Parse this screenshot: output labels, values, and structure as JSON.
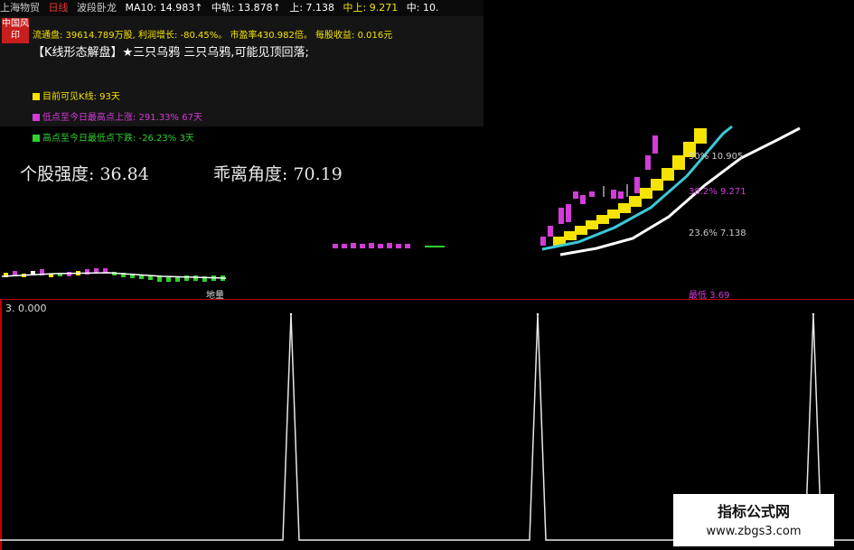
{
  "header": {
    "stock_name": "上海物贸",
    "period": "日线",
    "indicator_name": "波段卧龙",
    "ma10": "MA10: 14.983↑",
    "mid_track": "中轨: 13.878↑",
    "upper": "上: 7.138",
    "mid_upper": "中上: 9.271",
    "mid": "中: 10."
  },
  "seal_text": "中国风印",
  "stats": {
    "float_shares": "流通盘: 39614.789万股",
    "profit_growth": "利润增长: -80.45%",
    "pe_ratio": "市盈率430.982倍",
    "eps": "每股收益: 0.016元"
  },
  "pattern_text": "【K线形态解盘】★三只乌鸦 三只乌鸦,可能见顶回落;",
  "legend": [
    {
      "label": "目前可见K线: 93天",
      "color": "#f5e400"
    },
    {
      "label": "低点至今日最高点上涨: 291.33% 67天",
      "color": "#d23cd8"
    },
    {
      "label": "高点至今日最低点下跌: -26.23% 3天",
      "color": "#2fd12f"
    }
  ],
  "strength_text": "个股强度: 36.84",
  "deviation_text": "乖离角度: 70.19",
  "fib_levels": [
    {
      "label": "50%  10.905"
    },
    {
      "label": "38.2%  9.271"
    },
    {
      "label": "23.6%  7.138"
    }
  ],
  "lowest_text": "最低  3.69",
  "ground_label": "地量",
  "sub_panel_value": "3. 0.000",
  "watermark": {
    "title": "指标公式网",
    "url": "www.zbgs3.com"
  },
  "chart_data": {
    "type": "line",
    "series": [
      {
        "values": [
          0,
          0,
          0,
          3,
          0,
          0,
          0,
          0,
          0,
          0,
          3,
          0,
          0,
          0,
          0,
          3,
          0
        ]
      }
    ],
    "ylim": [
      0,
      3
    ]
  },
  "colors": {
    "candle_up": "#d23cd8",
    "band_yellow": "#f5e400",
    "ma_cyan": "#3cc8d8",
    "ma_white": "#ffffff",
    "down_green": "#2fd12f",
    "grid_red": "#c00000"
  }
}
